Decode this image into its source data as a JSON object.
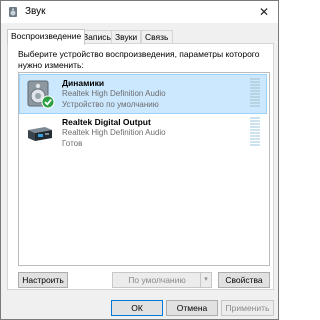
{
  "window": {
    "title": "Звук",
    "close_glyph": "✕"
  },
  "tabs": [
    {
      "label": "Воспроизведение",
      "active": true
    },
    {
      "label": "Запись",
      "active": false
    },
    {
      "label": "Звуки",
      "active": false
    },
    {
      "label": "Связь",
      "active": false
    }
  ],
  "instruction": "Выберите устройство воспроизведения, параметры которого нужно изменить:",
  "devices": [
    {
      "name": "Динамики",
      "driver": "Realtek High Definition Audio",
      "status": "Устройство по умолчанию",
      "icon": "speaker-icon",
      "selected": true,
      "default": true
    },
    {
      "name": "Realtek Digital Output",
      "driver": "Realtek High Definition Audio",
      "status": "Готов",
      "icon": "digital-output-icon",
      "selected": false,
      "default": false
    }
  ],
  "buttons": {
    "configure": "Настроить",
    "set_default": "По умолчанию",
    "properties": "Свойства",
    "ok": "ОК",
    "cancel": "Отмена",
    "apply": "Применить"
  },
  "colors": {
    "selection_bg": "#cce8ff",
    "default_check": "#2ea043",
    "accent": "#0078d7"
  }
}
